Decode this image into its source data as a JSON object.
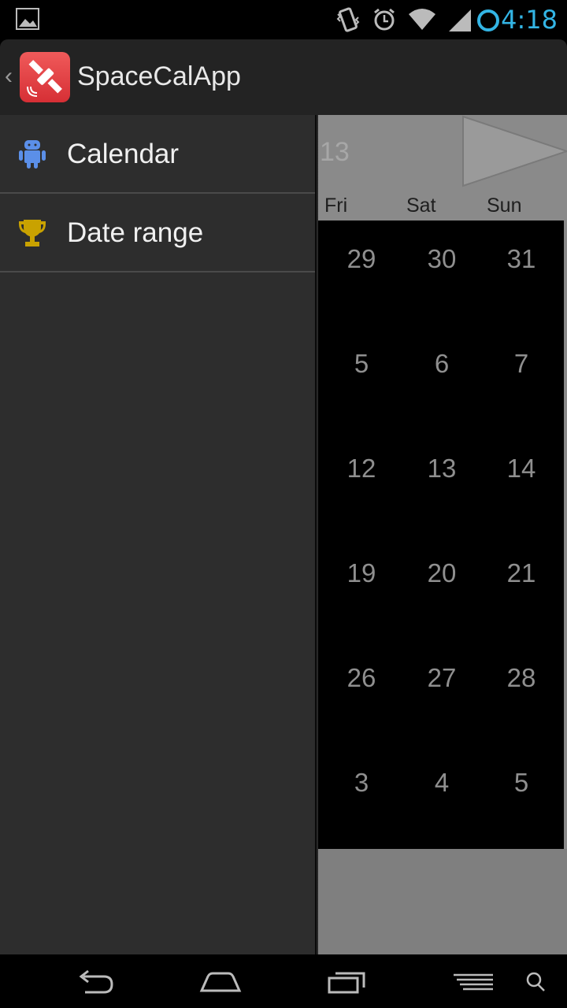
{
  "status_bar": {
    "time": "4:18",
    "icons": [
      "gallery-icon",
      "vibrate-icon",
      "alarm-icon",
      "wifi-icon",
      "signal-icon",
      "sync-icon"
    ],
    "time_color": "#33b5e5"
  },
  "action_bar": {
    "title": "SpaceCalApp",
    "icon": "satellite-icon",
    "icon_color": "#e84045"
  },
  "drawer": {
    "items": [
      {
        "label": "Calendar",
        "icon": "android-icon",
        "icon_color": "#5b8fe8"
      },
      {
        "label": "Date range",
        "icon": "trophy-icon",
        "icon_color": "#c9a200"
      }
    ]
  },
  "calendar": {
    "header_partial": "13",
    "weekdays": [
      "Fri",
      "Sat",
      "Sun"
    ],
    "weeks": [
      [
        "29",
        "30",
        "31"
      ],
      [
        "5",
        "6",
        "7"
      ],
      [
        "12",
        "13",
        "14"
      ],
      [
        "19",
        "20",
        "21"
      ],
      [
        "26",
        "27",
        "28"
      ],
      [
        "3",
        "4",
        "5"
      ]
    ]
  },
  "nav_bar": {
    "buttons": [
      "back-icon",
      "home-icon",
      "recents-icon",
      "menu-icon",
      "search-icon"
    ]
  }
}
